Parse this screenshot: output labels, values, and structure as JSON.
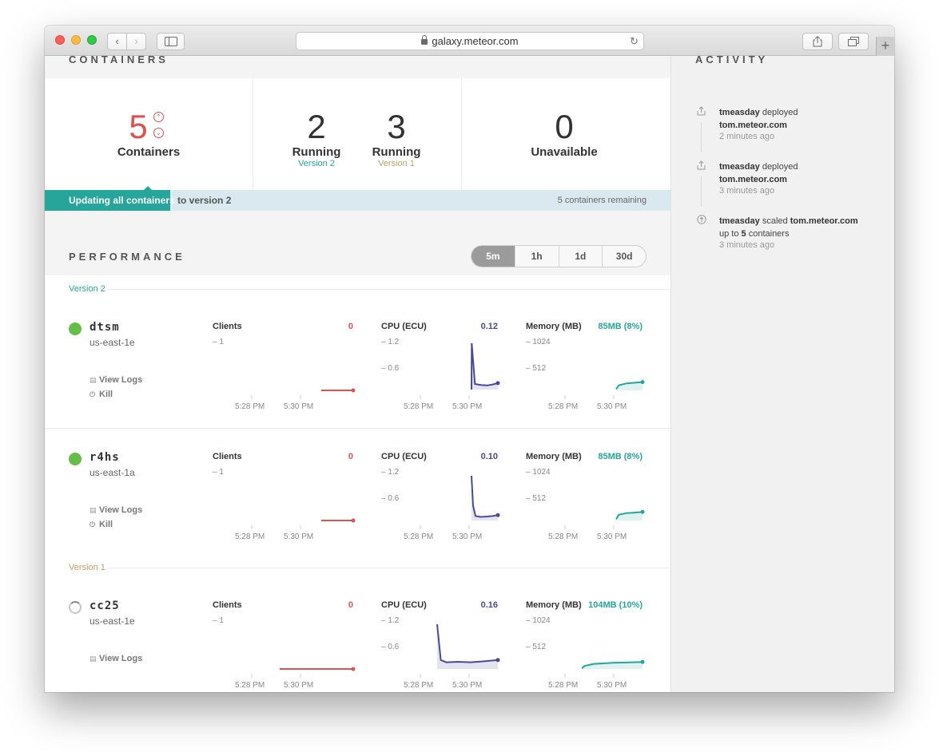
{
  "browser": {
    "url": "galaxy.meteor.com"
  },
  "containers": {
    "title": "CONTAINERS",
    "total": {
      "count": "5",
      "label": "Containers"
    },
    "running_v2": {
      "count": "2",
      "label": "Running",
      "version": "Version 2"
    },
    "running_v1": {
      "count": "3",
      "label": "Running",
      "version": "Version 1"
    },
    "unavailable": {
      "count": "0",
      "label": "Unavailable"
    },
    "update_text_highlight": "Updating all containers",
    "update_text_rest": " to version 2",
    "update_progress": 0.2,
    "remaining": "5 containers remaining"
  },
  "performance": {
    "title": "PERFORMANCE",
    "ranges": [
      "5m",
      "1h",
      "1d",
      "30d"
    ],
    "active_range": "5m",
    "version2_label": "Version 2",
    "version1_label": "Version 1",
    "clients_label": "Clients",
    "cpu_label": "CPU (ECU)",
    "memory_label": "Memory (MB)",
    "clients_ticks": [
      "1"
    ],
    "cpu_ticks": [
      "1.2",
      "0.6"
    ],
    "memory_ticks": [
      "1024",
      "512"
    ],
    "time_labels": [
      "5:28 PM",
      "5:30 PM"
    ],
    "view_logs": "View Logs",
    "kill": "Kill",
    "containers": [
      {
        "name": "dtsm",
        "region": "us-east-1e",
        "status": "running",
        "clients": "0",
        "cpu": "0.12",
        "memory": "85MB (8%)"
      },
      {
        "name": "r4hs",
        "region": "us-east-1a",
        "status": "running",
        "clients": "0",
        "cpu": "0.10",
        "memory": "85MB (8%)"
      },
      {
        "name": "cc25",
        "region": "us-east-1e",
        "status": "starting",
        "clients": "0",
        "cpu": "0.16",
        "memory": "104MB (10%)"
      }
    ]
  },
  "activity": {
    "title": "ACTIVITY",
    "items": [
      {
        "user": "tmeasday",
        "action": " deployed",
        "target": "tom.meteor.com",
        "time": "2 minutes ago"
      },
      {
        "user": "tmeasday",
        "action": " deployed",
        "target": "tom.meteor.com",
        "time": "3 minutes ago"
      },
      {
        "user": "tmeasday",
        "action": " scaled ",
        "target": "tom.meteor.com",
        "line2_pre": "up to ",
        "line2_bold": "5",
        "line2_post": " containers",
        "time": "3 minutes ago"
      }
    ]
  },
  "colors": {
    "accent_red": "#d9534f",
    "teal": "#26a69a",
    "version1": "#c0a06a",
    "cpu": "#4a4a9a",
    "memory": "#26a69a",
    "clients": "#d9534f",
    "running": "#64bd46"
  }
}
